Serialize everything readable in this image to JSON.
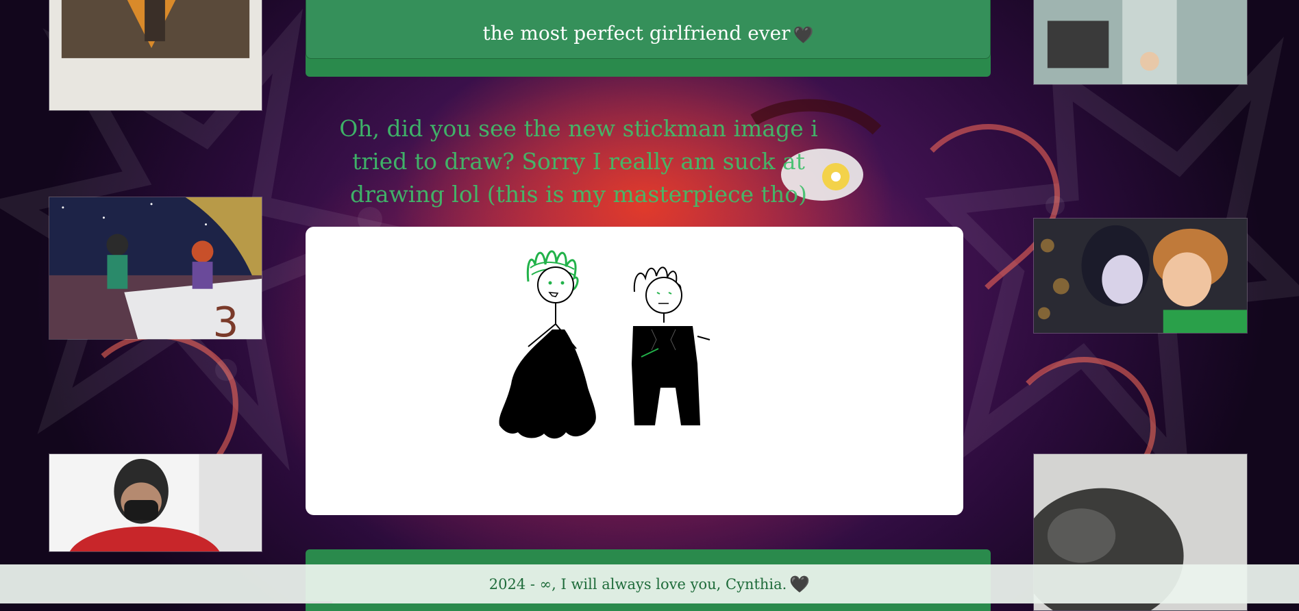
{
  "banner": {
    "text": "the most perfect girlfriend ever",
    "heart": "🖤"
  },
  "question": {
    "text": "Oh, did you see the new stickman image i tried to draw? Sorry I really am suck at drawing lol (this is my masterpiece tho)"
  },
  "footer": {
    "text": "2024 - ∞, I will always love you, Cynthia.",
    "heart": "🖤"
  },
  "photos": [
    {
      "name": "polaroid-portrait-photo"
    },
    {
      "name": "teen-titans-cartoon-photo"
    },
    {
      "name": "masked-person-selfie-photo"
    },
    {
      "name": "anime-screenshot-photo"
    },
    {
      "name": "hotel-transylvania-couple-photo"
    },
    {
      "name": "dark-blurry-photo"
    }
  ],
  "colors": {
    "accent_green": "#2a8a4c",
    "text_green": "#3fbf6b",
    "footer_text": "#1e6b3a"
  }
}
